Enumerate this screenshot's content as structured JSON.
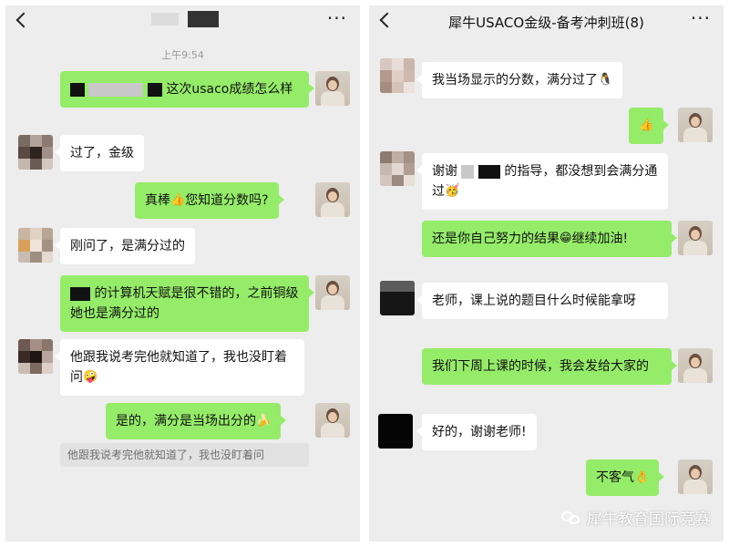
{
  "left": {
    "time": "上午9:54",
    "messages": [
      {
        "text": "这次usaco成绩怎么样"
      },
      {
        "text": "过了，金级"
      },
      {
        "text": "真棒",
        "emoji": "👍",
        "text2": "您知道分数吗?"
      },
      {
        "text": "刚问了，是满分过的"
      },
      {
        "text": "的计算机天赋是很不错的，之前铜级她也是满分过的"
      },
      {
        "text": "他跟我说考完他就知道了，我也没盯着问",
        "emoji": "🤪"
      },
      {
        "text": "是的，满分是当场出分的",
        "emoji": "🍌"
      }
    ],
    "quote": "他跟我说考完他就知道了，我也没盯着问"
  },
  "right": {
    "title": "犀牛USACO金级-备考冲刺班(8)",
    "messages": [
      {
        "text": "我当场显示的分数，满分过了",
        "emoji": "🐧"
      },
      {
        "emoji": "👍"
      },
      {
        "text": "谢谢",
        "text2": "的指导，都没想到会满分通过",
        "emoji": "🥳"
      },
      {
        "text": "还是你自己努力的结果",
        "emoji": "😁",
        "text2": "继续加油!"
      },
      {
        "text": "老师，课上说的题目什么时候能拿呀"
      },
      {
        "text": "我们下周上课的时候，我会发给大家的"
      },
      {
        "text": "好的，谢谢老师!"
      },
      {
        "text": "不客气",
        "emoji": "👌"
      }
    ],
    "watermark": "犀牛教育国际竞赛"
  },
  "icons": {
    "back": "chevron-left-icon",
    "more": "more-dots-icon",
    "watermark": "wechat-icon"
  },
  "more_glyph": "···",
  "colors": {
    "bubble_sent": "#95ec69",
    "bubble_received": "#ffffff",
    "background": "#ededed"
  }
}
